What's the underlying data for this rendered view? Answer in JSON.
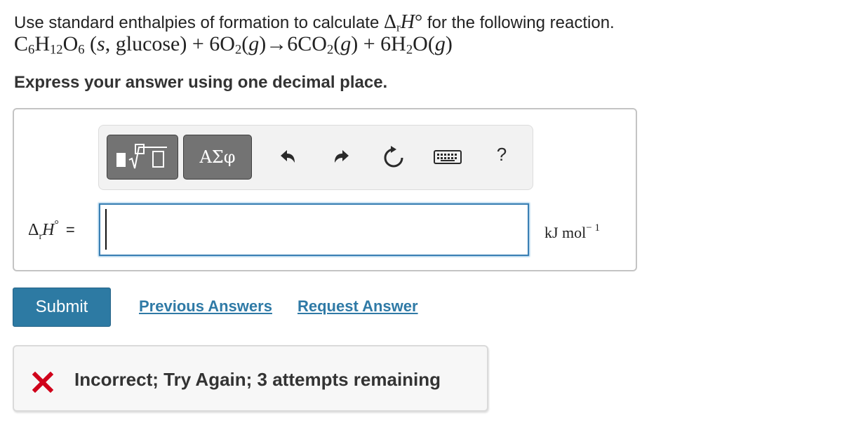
{
  "question": {
    "line1_text": "Use standard enthalpies of formation to calculate",
    "line1_math_delta": "Δ",
    "line1_math_sub": "r",
    "line1_math_H": "H",
    "line1_math_deg": "°",
    "line1_tail": "for the following reaction.",
    "reaction": {
      "glucose_prefix": "C",
      "glucose_sub1": "6",
      "glucose_h": "H",
      "glucose_sub2": "12",
      "glucose_o": "O",
      "glucose_sub3": "6",
      "glucose_state_s": "s",
      "glucose_state_name": "glucose",
      "plus1": "+",
      "o2_coef": "6O",
      "o2_sub": "2",
      "state_g": "g",
      "arrow": "→",
      "co2_coef": "6CO",
      "co2_sub": "2",
      "plus2": "+",
      "h2o_coef": "6H",
      "h2o_sub": "2",
      "h2o_o": "O"
    },
    "instruction": "Express your answer using one decimal place."
  },
  "toolbar": {
    "greek_label": "ΑΣφ",
    "help_label": "?",
    "icons": [
      "templates-icon",
      "undo-icon",
      "redo-icon",
      "reset-icon",
      "keyboard-icon",
      "help-icon"
    ]
  },
  "answer": {
    "label_delta": "Δ",
    "label_sub": "r",
    "label_H": "H",
    "label_deg": "°",
    "label_eq": "=",
    "value": "",
    "units_main": "kJ mol",
    "units_sup": "− 1"
  },
  "actions": {
    "submit_label": "Submit",
    "previous_answers_label": "Previous Answers",
    "request_answer_label": "Request Answer"
  },
  "feedback": {
    "message": "Incorrect; Try Again; 3 attempts remaining",
    "icon_color": "#d0021b"
  },
  "colors": {
    "submit_bg": "#2d7aa3",
    "link": "#2f7aa6",
    "input_border": "#3a7fb3"
  }
}
